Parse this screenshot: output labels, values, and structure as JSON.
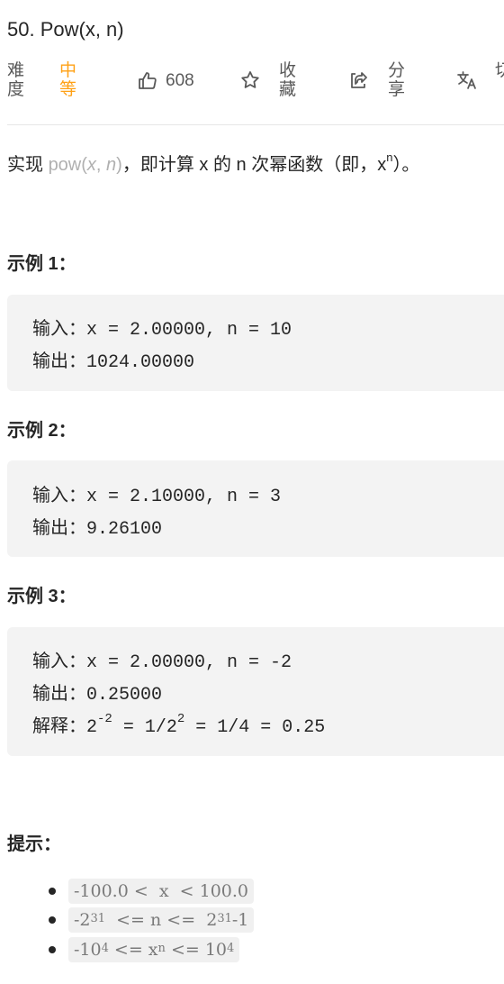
{
  "problem": {
    "title": "50. Pow(x, n)"
  },
  "meta": {
    "difficulty_label_line1": "难",
    "difficulty_label_line2": "度",
    "difficulty_value_line1": "中",
    "difficulty_value_line2": "等",
    "likes": "608",
    "favorite_line1": "收",
    "favorite_line2": "藏",
    "share_line1": "分",
    "share_line2": "享",
    "more_partial": "切",
    "difficulty_color": "#ffa116",
    "icons": [
      "thumbs-up-icon",
      "star-icon",
      "share-icon",
      "translate-icon"
    ]
  },
  "description": {
    "prefix": "实现 ",
    "code_fn": "pow(",
    "code_x": "x",
    "code_sep": ", ",
    "code_n": "n",
    "code_close": ")",
    "middle": "，即计算 x 的 n 次幂函数（即，x",
    "sup": "n",
    "suffix": "）。"
  },
  "examples": [
    {
      "title": "示例 1：",
      "input_label": "输入：",
      "input_value": "x = 2.00000, n = 10",
      "output_label": "输出：",
      "output_value": "1024.00000"
    },
    {
      "title": "示例 2：",
      "input_label": "输入：",
      "input_value": "x = 2.10000, n = 3",
      "output_label": "输出：",
      "output_value": "9.26100"
    },
    {
      "title": "示例 3：",
      "input_label": "输入：",
      "input_value": "x = 2.00000, n = -2",
      "output_label": "输出：",
      "output_value": "0.25000",
      "explain_label": "解释：",
      "explain_base": "2",
      "explain_exp": "-2",
      "explain_mid": " = 1/2",
      "explain_exp2": "2",
      "explain_tail": " = 1/4 = 0.25"
    }
  ],
  "hints": {
    "title": "提示：",
    "items": [
      {
        "a": "-100.0 <  x  < 100.0"
      },
      {
        "a": "-2",
        "sup1": "31",
        "b": "  <= n <=  2",
        "sup2": "31",
        "c": "-1"
      },
      {
        "a": "-10",
        "sup1": "4",
        "b": " <= x",
        "sup2": "n",
        "c": " <= 10",
        "sup3": "4"
      }
    ]
  }
}
